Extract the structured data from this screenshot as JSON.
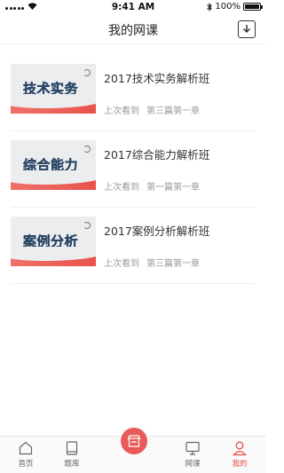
{
  "status_bar": {
    "time": "9:41 AM",
    "battery": "100%"
  },
  "nav": {
    "title": "我的网课",
    "action_icon": "download-icon"
  },
  "courses": [
    {
      "thumb_title": "技术实务",
      "thumb_subtitle": "注册消防工程师资格考试",
      "name": "2017技术实务解析班",
      "last_label": "上次看到",
      "last_chapter": "第三篇第一章"
    },
    {
      "thumb_title": "综合能力",
      "thumb_subtitle": "注册消防工程师资格考试",
      "name": "2017综合能力解析班",
      "last_label": "上次看到",
      "last_chapter": "第一篇第一章"
    },
    {
      "thumb_title": "案例分析",
      "thumb_subtitle": "注册消防工程师资格考试",
      "name": "2017案例分析解析班",
      "last_label": "上次看到",
      "last_chapter": "第三篇第一章"
    }
  ],
  "tabs": [
    {
      "label": "首页",
      "icon": "home-icon"
    },
    {
      "label": "题库",
      "icon": "book-icon"
    },
    {
      "label": "",
      "icon": "store-icon"
    },
    {
      "label": "网课",
      "icon": "monitor-icon"
    },
    {
      "label": "我的",
      "icon": "user-icon",
      "active": true
    }
  ],
  "colors": {
    "accent": "#e84b4b",
    "thumb_title": "#2b4866"
  }
}
